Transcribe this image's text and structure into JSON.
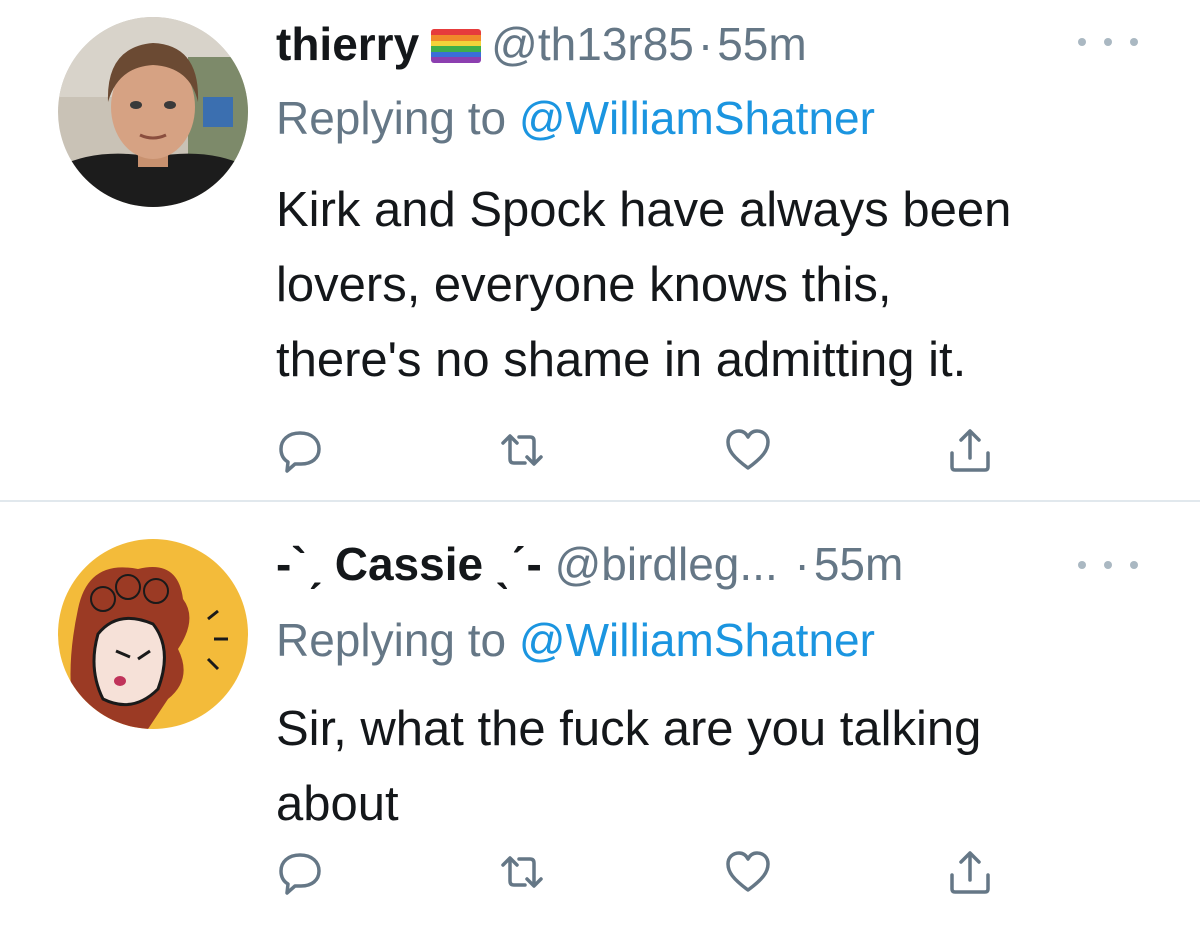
{
  "tweets": [
    {
      "display_name": "thierry",
      "flag_icon": "rainbow-flag-icon",
      "handle": "@th13r85",
      "separator": "·",
      "time": "55m",
      "replying_prefix": "Replying to ",
      "replying_to": "@WilliamShatner",
      "text": "Kirk and Spock have always been\nlovers, everyone knows this,\nthere's no shame in admitting it.",
      "avatar_icon": "profile-photo"
    },
    {
      "display_name": "-`ˏ Cassie ˎˊ-",
      "handle": "@birdleg...",
      "separator": "·",
      "time": "55m",
      "replying_prefix": "Replying to ",
      "replying_to": "@WilliamShatner",
      "text": "Sir, what the fuck are you talking\nabout",
      "avatar_icon": "cartoon-avatar"
    }
  ],
  "action_icons": [
    "reply-icon",
    "retweet-icon",
    "like-icon",
    "share-icon"
  ],
  "colors": {
    "text": "#14171a",
    "secondary": "#657786",
    "link": "#1b95e0",
    "icon": "#657786",
    "divider": "#e1e8ed"
  }
}
